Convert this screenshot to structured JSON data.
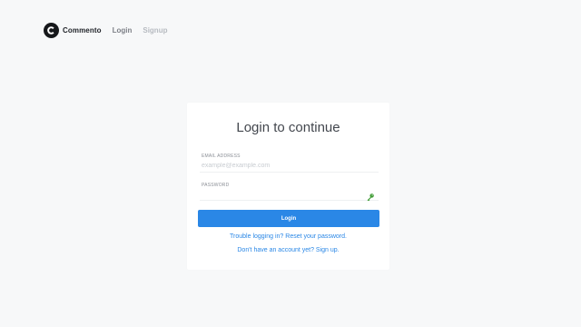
{
  "nav": {
    "brand": "Commento",
    "login": "Login",
    "signup": "Signup"
  },
  "card": {
    "title": "Login to continue",
    "email_label": "EMAIL ADDRESS",
    "email_placeholder": "example@example.com",
    "email_value": "",
    "password_label": "PASSWORD",
    "password_value": "",
    "login_button": "Login",
    "reset_link": "Trouble logging in? Reset your password.",
    "signup_link": "Don't have an account yet? Sign up."
  },
  "icons": {
    "logo": "commento-logo-icon",
    "password_manager": "key-icon"
  },
  "colors": {
    "background": "#f7f8f9",
    "accent": "#2a87e6",
    "key_icon": "#3f9c35"
  }
}
